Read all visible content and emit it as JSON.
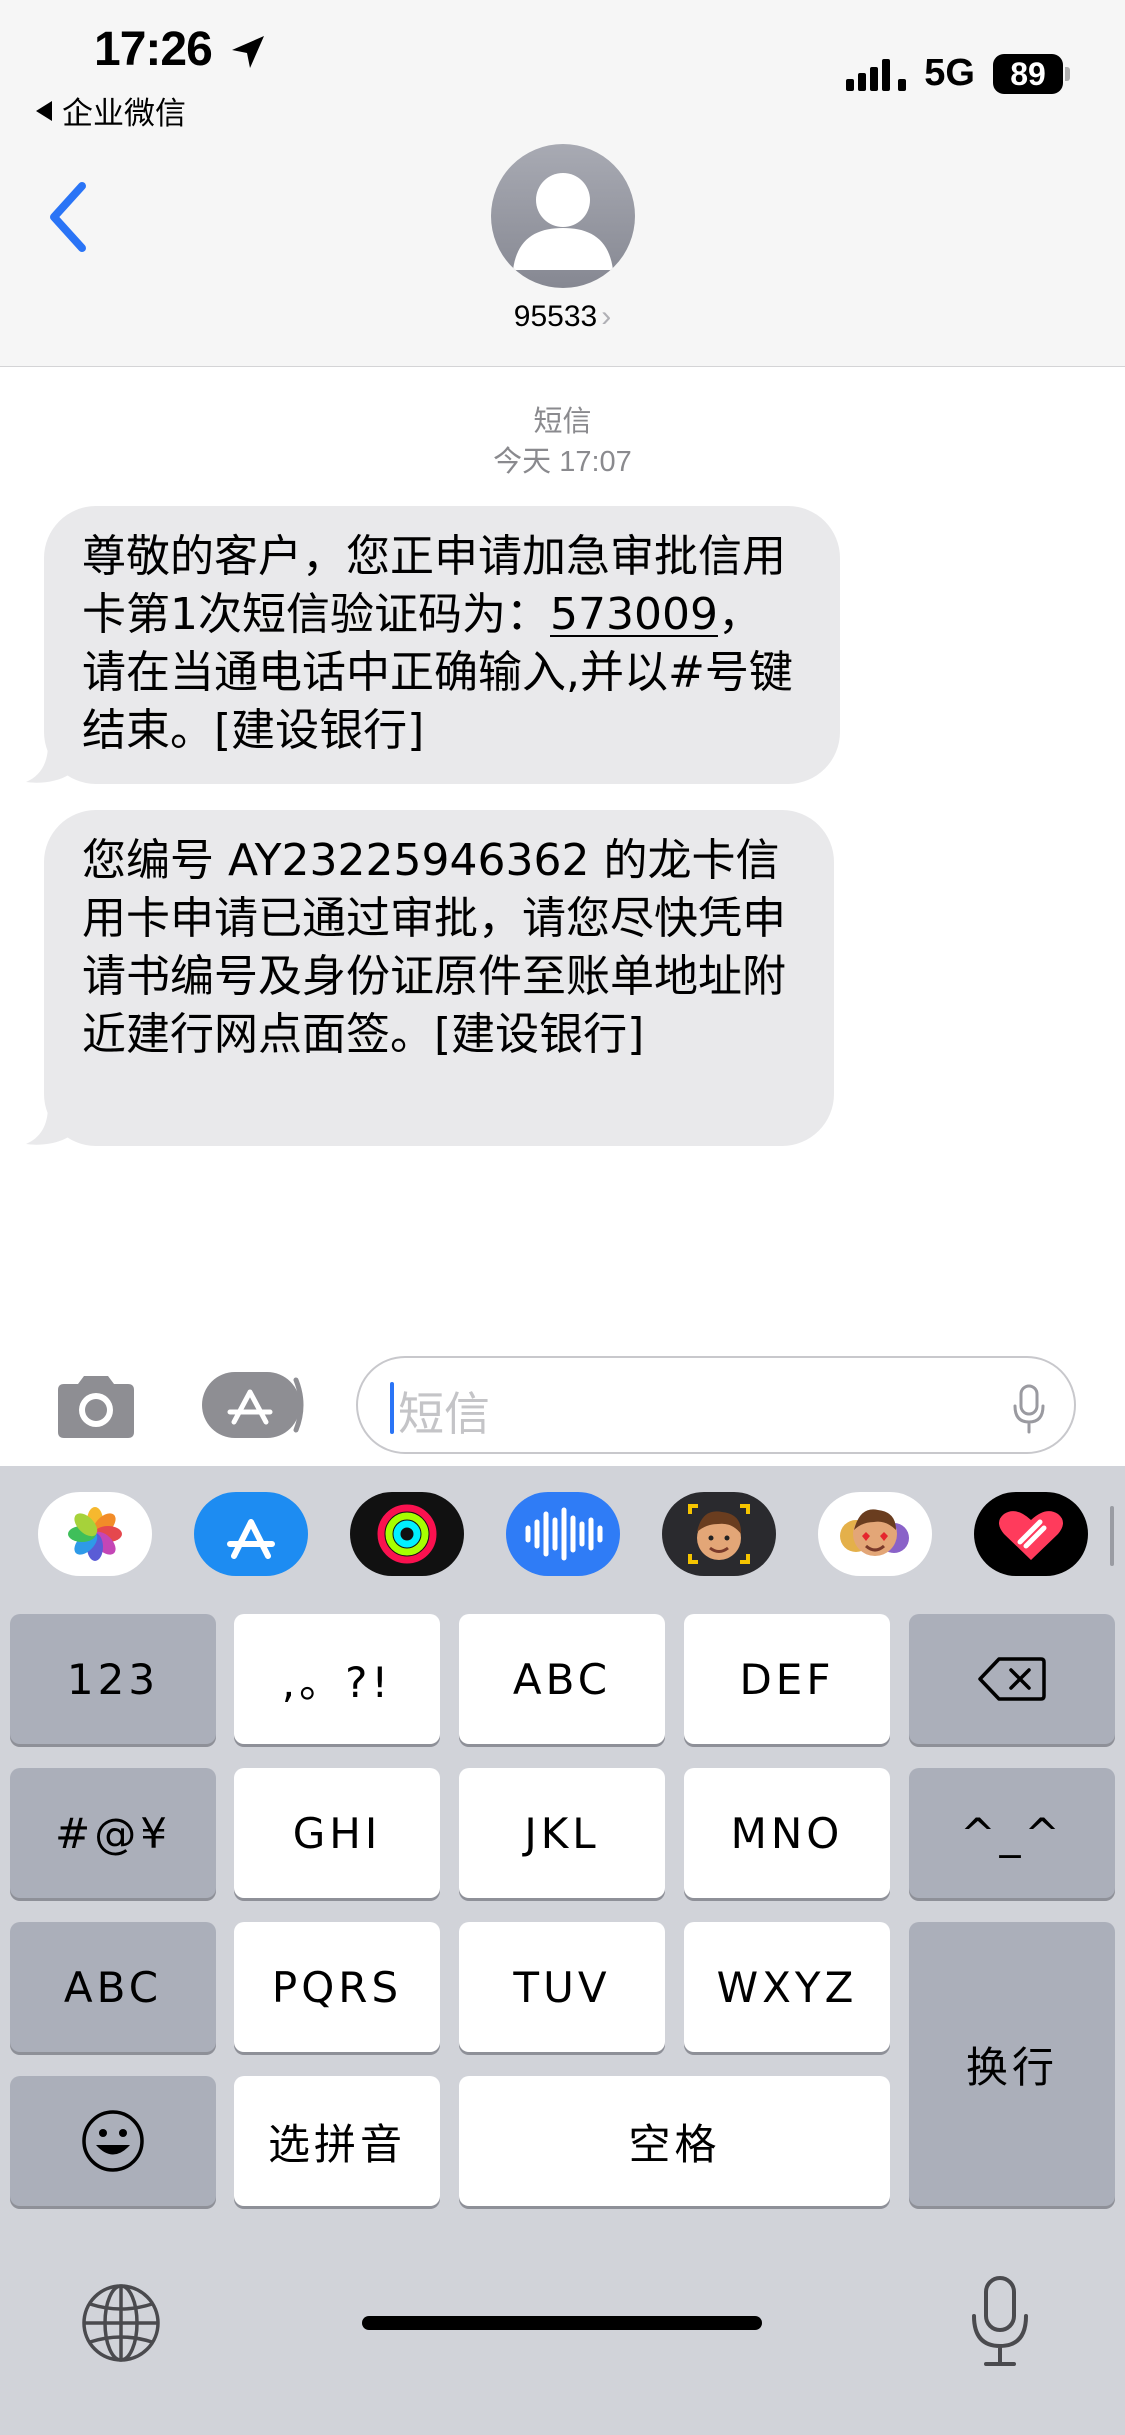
{
  "status_bar": {
    "time": "17:26",
    "back_app": "企业微信",
    "network": "5G",
    "battery": "89"
  },
  "conversation": {
    "contact": "95533",
    "meta_service": "短信",
    "meta_timestamp": "今天 17:07"
  },
  "messages": [
    {
      "pre": "尊敬的客户，您正申请加急审批信用卡第1次短信验证码为：",
      "code": "573009",
      "post": "，请在当通电话中正确输入,并以#号键结束。[建设银行]"
    },
    {
      "text": "您编号 AY23225946362 的龙卡信用卡申请已通过审批，请您尽快凭申请书编号及身份证原件至账单地址附近建行网点面签。[建设银行]"
    }
  ],
  "composer": {
    "placeholder": "短信"
  },
  "app_strip": [
    "photos-icon",
    "app-store-icon",
    "fitness-activity-icon",
    "audio-message-icon",
    "memoji-icon",
    "memoji-stickers-icon",
    "digital-touch-icon"
  ],
  "keyboard": {
    "k123": "123",
    "punct": ",。?!",
    "abc_key": "ABC",
    "def_key": "DEF",
    "symbols": "#@¥",
    "ghi": "GHI",
    "jkl": "JKL",
    "mno": "MNO",
    "emoticon": "^_^",
    "abc_mode": "ABC",
    "pqrs": "PQRS",
    "tuv": "TUV",
    "wxyz": "WXYZ",
    "return_label": "换行",
    "pinyin": "选拼音",
    "space": "空格"
  },
  "colors": {
    "accent": "#2a74f6",
    "bubble_received": "#e9e9eb",
    "keyboard_bg": "#d1d3d9"
  }
}
